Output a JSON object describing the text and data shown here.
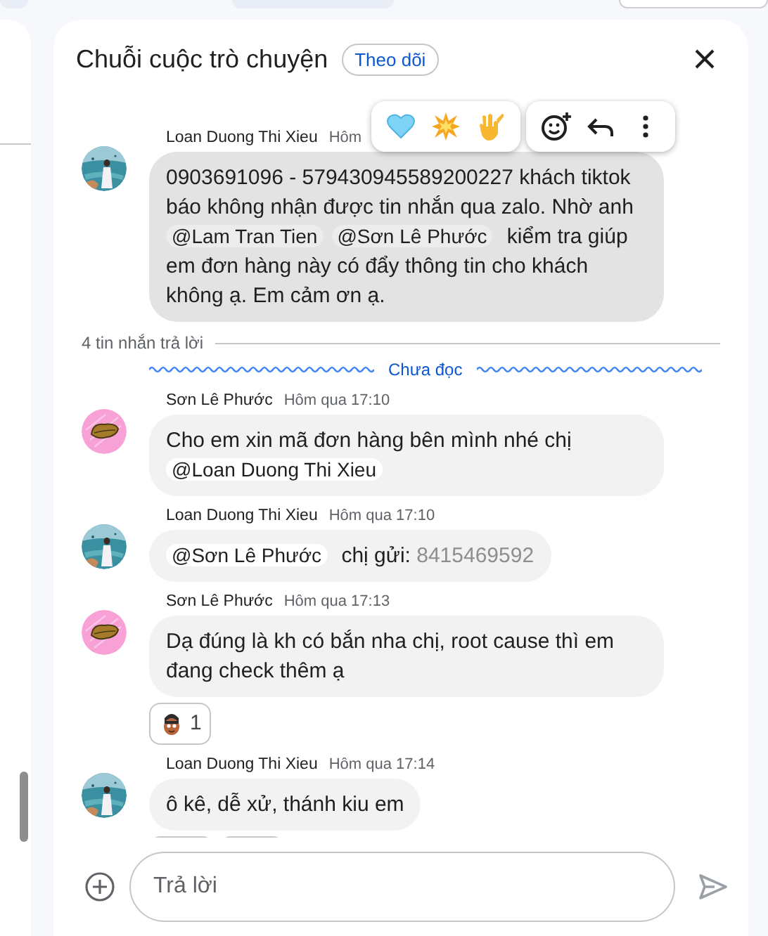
{
  "panel": {
    "title": "Chuỗi cuộc trò chuyện",
    "follow_button": "Theo dõi"
  },
  "hover_toolbar": {
    "reactions": [
      {
        "kind": "heart"
      },
      {
        "kind": "burst"
      },
      {
        "kind": "hand"
      }
    ],
    "actions": [
      {
        "kind": "add-emoji"
      },
      {
        "kind": "reply"
      },
      {
        "kind": "more"
      }
    ]
  },
  "root_message": {
    "author": "Loan Duong Thi Xieu",
    "time": "Hôm",
    "avatar": {
      "kind": "picture"
    },
    "hovered": true,
    "parts": [
      {
        "kind": "text",
        "text": "0903691096 - 579430945589200227 khách tiktok báo không nhận được tin nhắn qua zalo. Nhờ anh "
      },
      {
        "kind": "mention",
        "at": "@",
        "name": "Lam Tran Tien"
      },
      {
        "kind": "mention",
        "at": "@",
        "name": "Sơn Lê Phước"
      },
      {
        "kind": "text",
        "text": " kiểm tra giúp em đơn hàng này có đẩy thông tin cho khách không ạ. Em cảm ơn ạ."
      }
    ]
  },
  "reply_count": "4 tin nhắn trả lời",
  "unread_label": "Chưa đọc",
  "replies": [
    {
      "author": "Sơn Lê Phước",
      "time": "Hôm qua 17:10",
      "avatar": {
        "kind": "icon"
      },
      "hovered": false,
      "parts": [
        {
          "kind": "text",
          "text": "Cho em xin mã đơn hàng bên mình nhé chị "
        },
        {
          "kind": "mention",
          "at": "@",
          "name": "Loan Duong Thi Xieu"
        }
      ]
    },
    {
      "author": "Loan Duong Thi Xieu",
      "time": "Hôm qua 17:10",
      "avatar": {
        "kind": "picture"
      },
      "hovered": false,
      "parts": [
        {
          "kind": "mention",
          "at": "@",
          "name": "Sơn Lê Phước"
        },
        {
          "kind": "text",
          "text": " chị gửi: "
        },
        {
          "kind": "muted",
          "text": "8415469592"
        }
      ]
    },
    {
      "author": "Sơn Lê Phước",
      "time": "Hôm qua 17:13",
      "avatar": {
        "kind": "icon"
      },
      "hovered": false,
      "parts": [
        {
          "kind": "text",
          "text": "Dạ đúng là kh có bắn nha chị, root cause thì em đang check thêm ạ"
        }
      ],
      "reactions": [
        {
          "kind": "face",
          "count": "1"
        }
      ]
    },
    {
      "author": "Loan Duong Thi Xieu",
      "time": "Hôm qua 17:14",
      "avatar": {
        "kind": "picture"
      },
      "hovered": false,
      "parts": [
        {
          "kind": "text",
          "text": "ô kê, dễ xử, thánh kiu em"
        }
      ],
      "reactions": [
        {
          "kind": "cut"
        },
        {
          "kind": "cut"
        }
      ]
    }
  ],
  "reply_field": {
    "placeholder": "Trả lời"
  }
}
